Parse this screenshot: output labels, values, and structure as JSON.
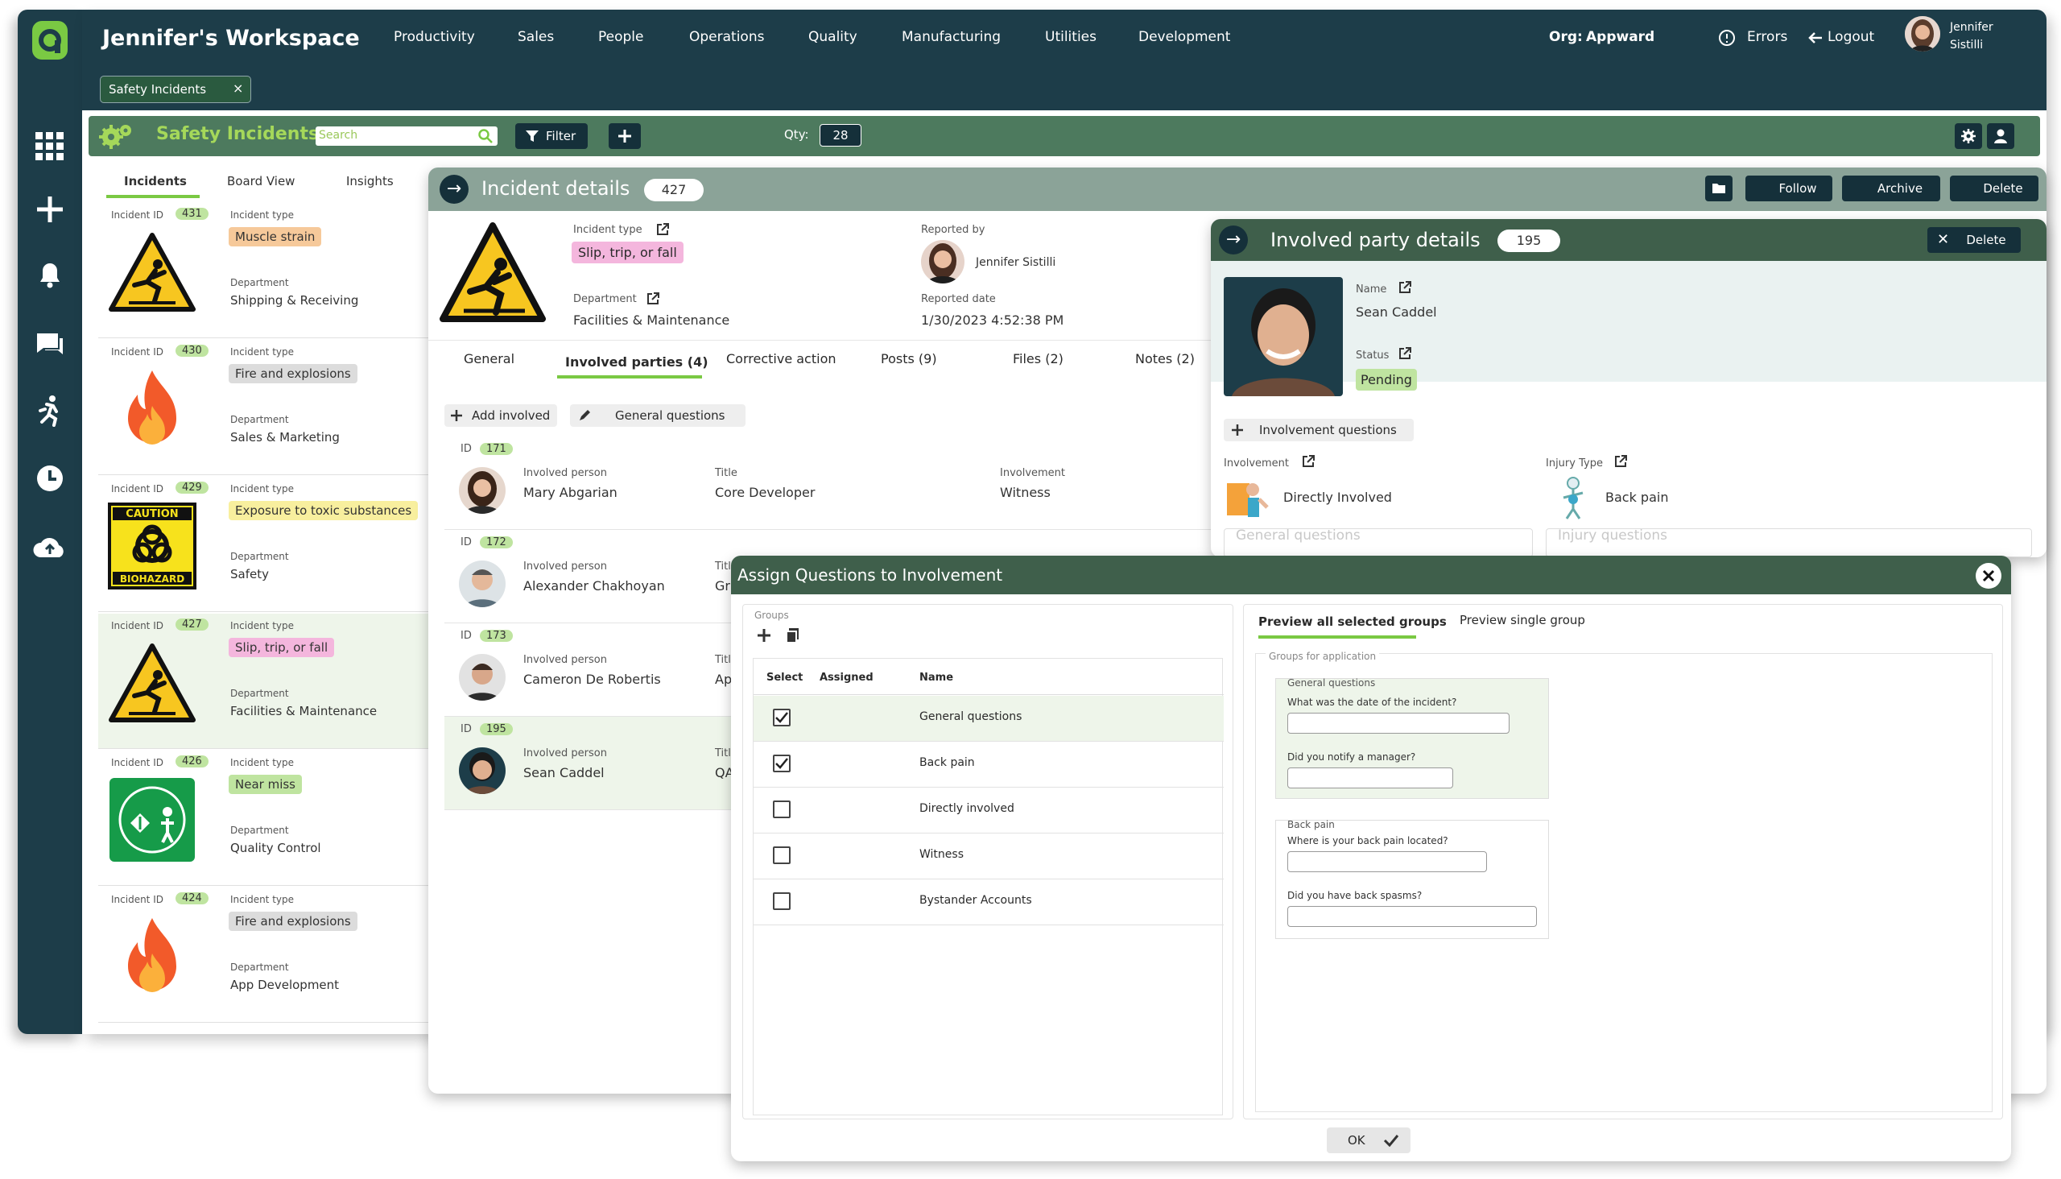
{
  "nav": {
    "workspace": "Jennifer's Workspace",
    "menu": [
      "Productivity",
      "Sales",
      "People",
      "Operations",
      "Quality",
      "Manufacturing",
      "Utilities",
      "Development"
    ],
    "org_label": "Org:",
    "org_value": "Appward",
    "errors": "Errors",
    "logout": "Logout",
    "user_first": "Jennifer",
    "user_last": "Sistilli"
  },
  "chips": [
    {
      "label": "Safety Incidents",
      "close": "×"
    }
  ],
  "toolbar": {
    "title": "Safety Incidents",
    "search_placeholder": "Search",
    "filter": "Filter",
    "qty_label": "Qty:",
    "qty": "28"
  },
  "list_tabs": [
    "Incidents",
    "Board View",
    "Insights"
  ],
  "incidents": [
    {
      "id_label": "Incident ID",
      "id": "431",
      "type_label": "Incident type",
      "type": "Muscle strain",
      "dept_label": "Department",
      "dept": "Shipping & Receiving",
      "icon": "slip-hazard-icon",
      "tag_color": "#f6c99a"
    },
    {
      "id_label": "Incident ID",
      "id": "430",
      "type_label": "Incident type",
      "type": "Fire and explosions",
      "dept_label": "Department",
      "dept": "Sales & Marketing",
      "icon": "fire-icon",
      "tag_color": "#dcdcdc"
    },
    {
      "id_label": "Incident ID",
      "id": "429",
      "type_label": "Incident type",
      "type": "Exposure to toxic substances",
      "dept_label": "Department",
      "dept": "Safety",
      "icon": "biohazard-icon",
      "tag_color": "#f8ef9e"
    },
    {
      "id_label": "Incident ID",
      "id": "427",
      "type_label": "Incident type",
      "type": "Slip, trip, or fall",
      "dept_label": "Department",
      "dept": "Facilities & Maintenance",
      "icon": "slip-hazard-icon",
      "tag_color": "#f4b6dd"
    },
    {
      "id_label": "Incident ID",
      "id": "426",
      "type_label": "Incident type",
      "type": "Near miss",
      "dept_label": "Department",
      "dept": "Quality Control",
      "icon": "safety-badge-icon",
      "tag_color": "#bfe4a0"
    },
    {
      "id_label": "Incident ID",
      "id": "424",
      "type_label": "Incident type",
      "type": "Fire and explosions",
      "dept_label": "Department",
      "dept": "App Development",
      "icon": "fire-icon",
      "tag_color": "#dcdcdc"
    }
  ],
  "incident_details": {
    "title": "Incident details",
    "id": "427",
    "buttons": {
      "follow": "Follow",
      "archive": "Archive",
      "delete": "Delete"
    },
    "type_label": "Incident type",
    "type": "Slip, trip, or fall",
    "dept_label": "Department",
    "dept": "Facilities & Maintenance",
    "reported_by_label": "Reported by",
    "reported_by": "Jennifer Sistilli",
    "reported_date_label": "Reported date",
    "reported_date": "1/30/2023 4:52:38 PM",
    "tabs": [
      "General",
      "Involved parties (4)",
      "Corrective action",
      "Posts (9)",
      "Files (2)",
      "Notes (2)"
    ],
    "add_involved": "Add involved",
    "general_questions": "General questions",
    "parties": [
      {
        "id_label": "ID",
        "id": "171",
        "person_label": "Involved person",
        "person": "Mary Abgarian",
        "title_label": "Title",
        "title": "Core Developer",
        "involvement_label": "Involvement",
        "involvement": "Witness"
      },
      {
        "id_label": "ID",
        "id": "172",
        "person_label": "Involved person",
        "person": "Alexander Chakhoyan",
        "title_label": "Title",
        "title": "Gra"
      },
      {
        "id_label": "ID",
        "id": "173",
        "person_label": "Involved person",
        "person": "Cameron De Robertis",
        "title_label": "Title",
        "title": "App"
      },
      {
        "id_label": "ID",
        "id": "195",
        "person_label": "Involved person",
        "person": "Sean Caddel",
        "title_label": "Title",
        "title": "QA"
      }
    ]
  },
  "party_details": {
    "title": "Involved party details",
    "id": "195",
    "delete": "Delete",
    "name_label": "Name",
    "name": "Sean Caddel",
    "status_label": "Status",
    "status": "Pending",
    "involvement_questions": "Involvement questions",
    "involvement_label": "Involvement",
    "involvement": "Directly Involved",
    "injury_label": "Injury Type",
    "injury": "Back pain",
    "faded_left": "General questions",
    "faded_right": "Injury questions"
  },
  "assign_dialog": {
    "title": "Assign Questions to Involvement",
    "groups_label": "Groups",
    "columns": [
      "Select",
      "Assigned",
      "Name"
    ],
    "rows": [
      {
        "name": "General questions",
        "checked": true
      },
      {
        "name": "Back pain",
        "checked": true
      },
      {
        "name": "Directly involved",
        "checked": false
      },
      {
        "name": "Witness",
        "checked": false
      },
      {
        "name": "Bystander Accounts",
        "checked": false
      }
    ],
    "preview_tabs": [
      "Preview all selected groups",
      "Preview single group"
    ],
    "groups_for_application": "Groups for application",
    "preview_groups": [
      {
        "name": "General questions",
        "questions": [
          "What was the date of the incident?",
          "Did you notify a manager?"
        ]
      },
      {
        "name": "Back pain",
        "questions": [
          "Where is your back pain located?",
          "Did you have back spasms?"
        ]
      }
    ],
    "ok": "OK"
  },
  "colors": {
    "dark": "#1d3d49",
    "green": "#4d7a5e",
    "accent": "#7ac943",
    "dialog_head": "#3f5f4b"
  }
}
